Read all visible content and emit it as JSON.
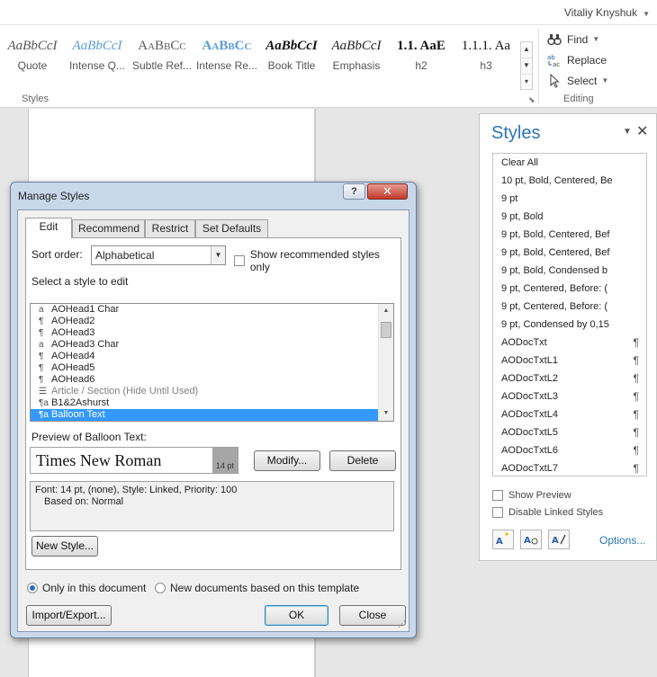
{
  "window": {
    "user_name": "Vitaliy Knyshuk"
  },
  "ribbon": {
    "styles_gallery": [
      {
        "sample": "AaBbCcI",
        "label": "Quote",
        "color": "#555555",
        "italic": true
      },
      {
        "sample": "AaBbCcI",
        "label": "Intense Q...",
        "color": "#5b9bd5",
        "italic": true
      },
      {
        "sample": "AaBbCc",
        "label": "Subtle Ref...",
        "color": "#595959",
        "small_caps": true
      },
      {
        "sample": "AaBbCc",
        "label": "Intense Re...",
        "color": "#5b9bd5",
        "bold": true,
        "small_caps": true
      },
      {
        "sample": "AaBbCcI",
        "label": "Book Title",
        "color": "#111111",
        "bold": true,
        "italic": true
      },
      {
        "sample": "AaBbCcI",
        "label": "Emphasis",
        "color": "#222222",
        "italic": true
      },
      {
        "sample": "1.1.  AaE",
        "label": "h2",
        "color": "#111111",
        "bold": true
      },
      {
        "sample": "1.1.1.  Aa",
        "label": "h3",
        "color": "#111111"
      }
    ],
    "styles_group_label": "Styles",
    "editing": {
      "find": "Find",
      "replace": "Replace",
      "select": "Select",
      "group_label": "Editing"
    }
  },
  "styles_pane": {
    "title": "Styles",
    "items": [
      {
        "label": "Clear All",
        "mark": ""
      },
      {
        "label": "10 pt, Bold, Centered, Be",
        "mark": ""
      },
      {
        "label": "9 pt",
        "mark": ""
      },
      {
        "label": "9 pt, Bold",
        "mark": ""
      },
      {
        "label": "9 pt, Bold, Centered, Bef",
        "mark": ""
      },
      {
        "label": "9 pt, Bold, Centered, Bef",
        "mark": ""
      },
      {
        "label": "9 pt, Bold, Condensed b",
        "mark": ""
      },
      {
        "label": "9 pt, Centered, Before:  (",
        "mark": ""
      },
      {
        "label": "9 pt, Centered, Before:  (",
        "mark": ""
      },
      {
        "label": "9 pt, Condensed by  0,15",
        "mark": ""
      },
      {
        "label": "AODocTxt",
        "mark": "¶"
      },
      {
        "label": "AODocTxtL1",
        "mark": "¶"
      },
      {
        "label": "AODocTxtL2",
        "mark": "¶"
      },
      {
        "label": "AODocTxtL3",
        "mark": "¶"
      },
      {
        "label": "AODocTxtL4",
        "mark": "¶"
      },
      {
        "label": "AODocTxtL5",
        "mark": "¶"
      },
      {
        "label": "AODocTxtL6",
        "mark": "¶"
      },
      {
        "label": "AODocTxtL7",
        "mark": "¶"
      }
    ],
    "show_preview": "Show Preview",
    "disable_linked": "Disable Linked Styles",
    "options_link": "Options..."
  },
  "dialog": {
    "title": "Manage Styles",
    "help_label": "?",
    "close_label": "✕",
    "tabs": [
      "Edit",
      "Recommend",
      "Restrict",
      "Set Defaults"
    ],
    "active_tab": "Edit",
    "sort_label": "Sort order:",
    "sort_value": "Alphabetical",
    "show_recommended": "Show recommended styles only",
    "select_label": "Select a style to edit",
    "style_list": [
      {
        "glyph": "a",
        "label": "AOHead1 Char"
      },
      {
        "glyph": "¶",
        "label": "AOHead2"
      },
      {
        "glyph": "¶",
        "label": "AOHead3"
      },
      {
        "glyph": "a",
        "label": "AOHead3 Char"
      },
      {
        "glyph": "¶",
        "label": "AOHead4"
      },
      {
        "glyph": "¶",
        "label": "AOHead5"
      },
      {
        "glyph": "¶",
        "label": "AOHead6"
      },
      {
        "glyph": "☰",
        "label": "Article / Section  (Hide Until Used)",
        "dim": true
      },
      {
        "glyph": "¶a",
        "label": "B1&2Ashurst"
      },
      {
        "glyph": "¶a",
        "label": "Balloon Text",
        "selected": true
      }
    ],
    "preview_label": "Preview of Balloon Text:",
    "preview_font": "Times New Roman",
    "preview_size": "14 pt",
    "modify_button": "Modify...",
    "delete_button": "Delete",
    "description_line1": "Font: 14 pt, (none), Style: Linked, Priority: 100",
    "description_line2": "Based on: Normal",
    "new_style_button": "New Style...",
    "scope_only_doc": "Only in this document",
    "scope_new_docs": "New documents based on this template",
    "import_export_button": "Import/Export...",
    "ok_button": "OK",
    "close_button": "Close"
  }
}
